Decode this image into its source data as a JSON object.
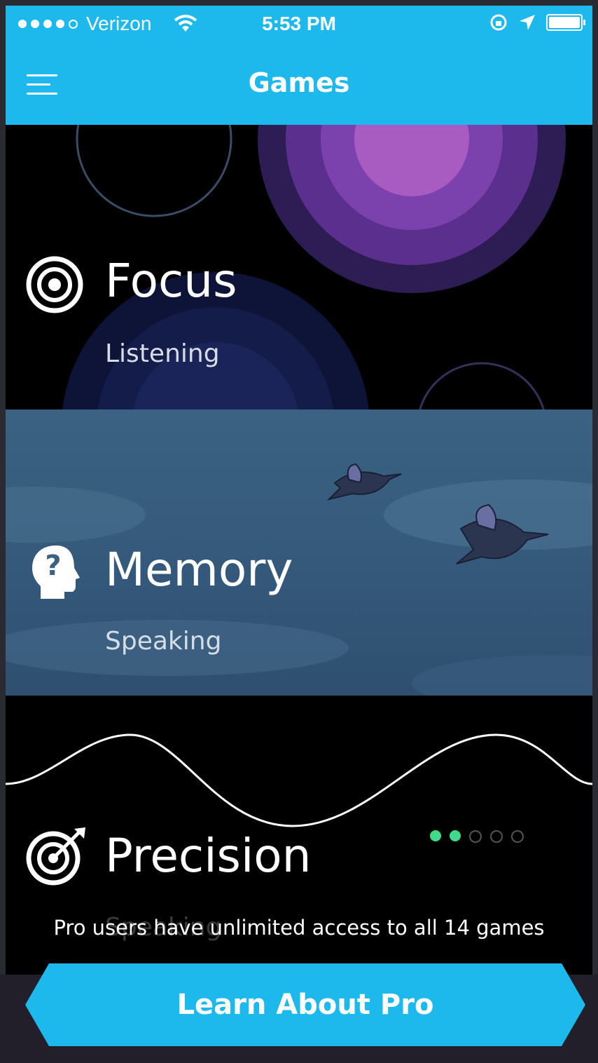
{
  "status_bar": {
    "carrier": "Verizon",
    "time": "5:53 PM",
    "signal_bars": 4
  },
  "header": {
    "title": "Games"
  },
  "games": [
    {
      "title": "Focus",
      "subtitle": "Listening",
      "icon": "target-icon"
    },
    {
      "title": "Memory",
      "subtitle": "Speaking",
      "icon": "head-question-icon"
    },
    {
      "title": "Precision",
      "subtitle": "Speaking",
      "icon": "bullseye-arrow-icon"
    }
  ],
  "pager": {
    "total": 5,
    "active": 2
  },
  "pro": {
    "note": "Pro users have unlimited access to all 14 games",
    "button_label": "Learn About Pro"
  },
  "colors": {
    "header": "#1db9ec",
    "button": "#1db9ec",
    "pager_active": "#3fdb8a"
  }
}
